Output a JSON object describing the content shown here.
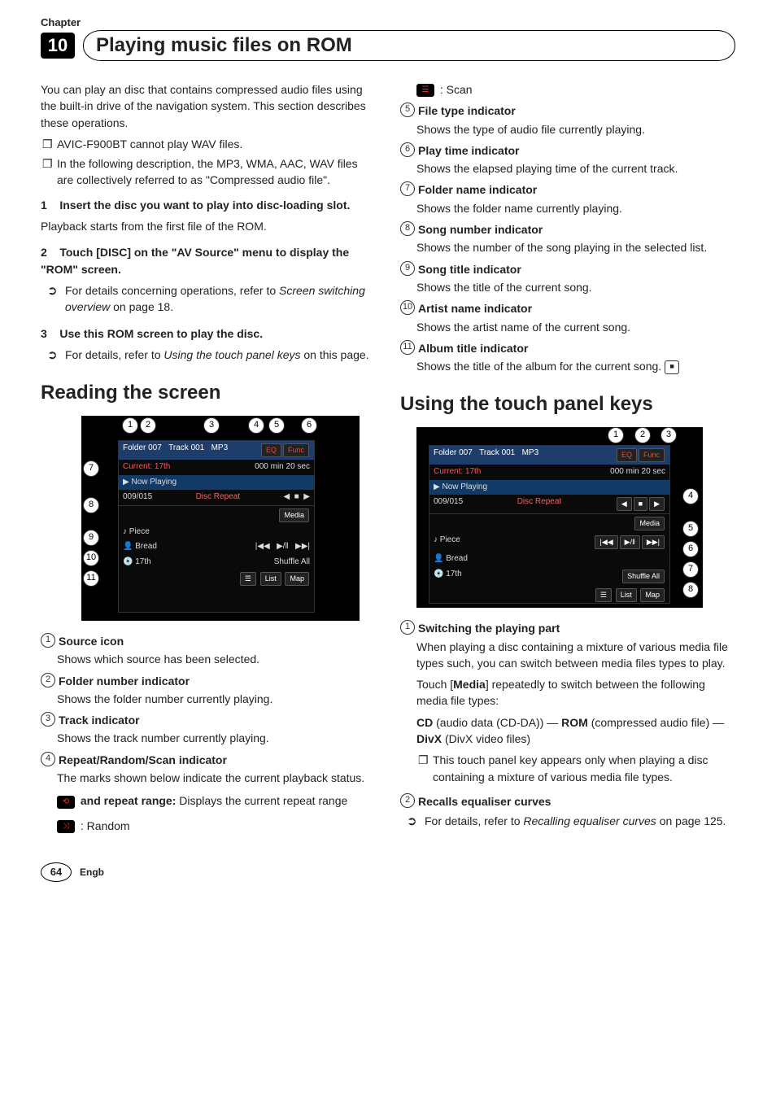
{
  "chapter": {
    "label": "Chapter",
    "number": "10",
    "title": "Playing music files on ROM"
  },
  "introPara": "You can play an disc that contains compressed audio files using the built-in drive of the navigation system. This section describes these operations.",
  "introBullets": [
    "AVIC-F900BT cannot play WAV files.",
    "In the following description, the MP3, WMA, AAC, WAV files are collectively referred to as \"Compressed audio file\"."
  ],
  "steps": [
    {
      "num": "1",
      "title": "Insert the disc you want to play into disc-loading slot.",
      "after": "Playback starts from the first file of the ROM."
    },
    {
      "num": "2",
      "title": "Touch [DISC] on the \"AV Source\" menu to display the \"ROM\" screen.",
      "sub": [
        {
          "pre": "For details concerning operations, refer to ",
          "em": "Screen switching overview",
          "post": " on page 18."
        }
      ]
    },
    {
      "num": "3",
      "title": "Use this ROM screen to play the disc.",
      "sub": [
        {
          "pre": "For details, refer to ",
          "em": "Using the touch panel keys",
          "post": " on this page."
        }
      ]
    }
  ],
  "sectionA": "Reading the screen",
  "figure1": {
    "topNums": [
      "1",
      "2",
      "3",
      "4",
      "5",
      "6"
    ],
    "leftNums": [
      "7",
      "8",
      "9",
      "10",
      "11"
    ],
    "hdrFolder": "Folder 007",
    "hdrTrack": "Track 001",
    "hdrMp3": "MP3",
    "hdrEq": "EQ",
    "hdrFunc": "Func",
    "current": "Current: 17th",
    "time": "000 min 20 sec",
    "nowPlaying": "▶ Now Playing",
    "count": "009/015",
    "repeat": "Disc Repeat",
    "piece": "Piece",
    "bread": "Bread",
    "seventeenth": "17th",
    "media": "Media",
    "shuffle": "Shuffle All",
    "list": "List",
    "map": "Map"
  },
  "glossaryA": [
    {
      "n": "1",
      "t": "Source icon",
      "d": "Shows which source has been selected."
    },
    {
      "n": "2",
      "t": "Folder number indicator",
      "d": "Shows the folder number currently playing."
    },
    {
      "n": "3",
      "t": "Track indicator",
      "d": "Shows the track number currently playing."
    },
    {
      "n": "4",
      "t": "Repeat/Random/Scan indicator",
      "d": "The marks shown below indicate the current playback status."
    }
  ],
  "repeatLine": {
    "label": " and repeat range:",
    "desc": " Displays the current repeat range"
  },
  "randomLine": ": Random",
  "scanLine": ": Scan",
  "glossaryA2": [
    {
      "n": "5",
      "t": "File type indicator",
      "d": "Shows the type of audio file currently playing."
    },
    {
      "n": "6",
      "t": "Play time indicator",
      "d": "Shows the elapsed playing time of the current track."
    },
    {
      "n": "7",
      "t": "Folder name indicator",
      "d": "Shows the folder name currently playing."
    },
    {
      "n": "8",
      "t": "Song number indicator",
      "d": "Shows the number of the song playing in the selected list."
    },
    {
      "n": "9",
      "t": "Song title indicator",
      "d": "Shows the title of the current song."
    },
    {
      "n": "10",
      "t": "Artist name indicator",
      "d": "Shows the artist name of the current song."
    },
    {
      "n": "11",
      "t": "Album title indicator",
      "d": "Shows the title of the album for the current song."
    }
  ],
  "endSymbol": "■",
  "sectionB": "Using the touch panel keys",
  "figure2": {
    "topNums": [
      "1",
      "2",
      "3"
    ],
    "rightNums": [
      "4",
      "5",
      "6",
      "7",
      "8"
    ]
  },
  "glossaryB": [
    {
      "n": "1",
      "t": "Switching the playing part",
      "lines": [
        "When playing a disc containing a mixture of various media file types such, you can switch between media files types to play.",
        "Touch [Media] repeatedly to switch between the following media file types:",
        "CD (audio data (CD-DA)) — ROM (compressed audio file) — DivX (DivX video files)"
      ],
      "bullet": "This touch panel key appears only when playing a disc containing a mixture of various media file types."
    },
    {
      "n": "2",
      "t": "Recalls equaliser curves",
      "sub": {
        "pre": "For details, refer to ",
        "em": "Recalling equaliser curves",
        "post": " on page 125."
      }
    }
  ],
  "mediaBold": "Media",
  "cdBold": "CD",
  "romBold": "ROM",
  "divxBold": "DivX",
  "footer": {
    "page": "64",
    "lang": "Engb"
  }
}
